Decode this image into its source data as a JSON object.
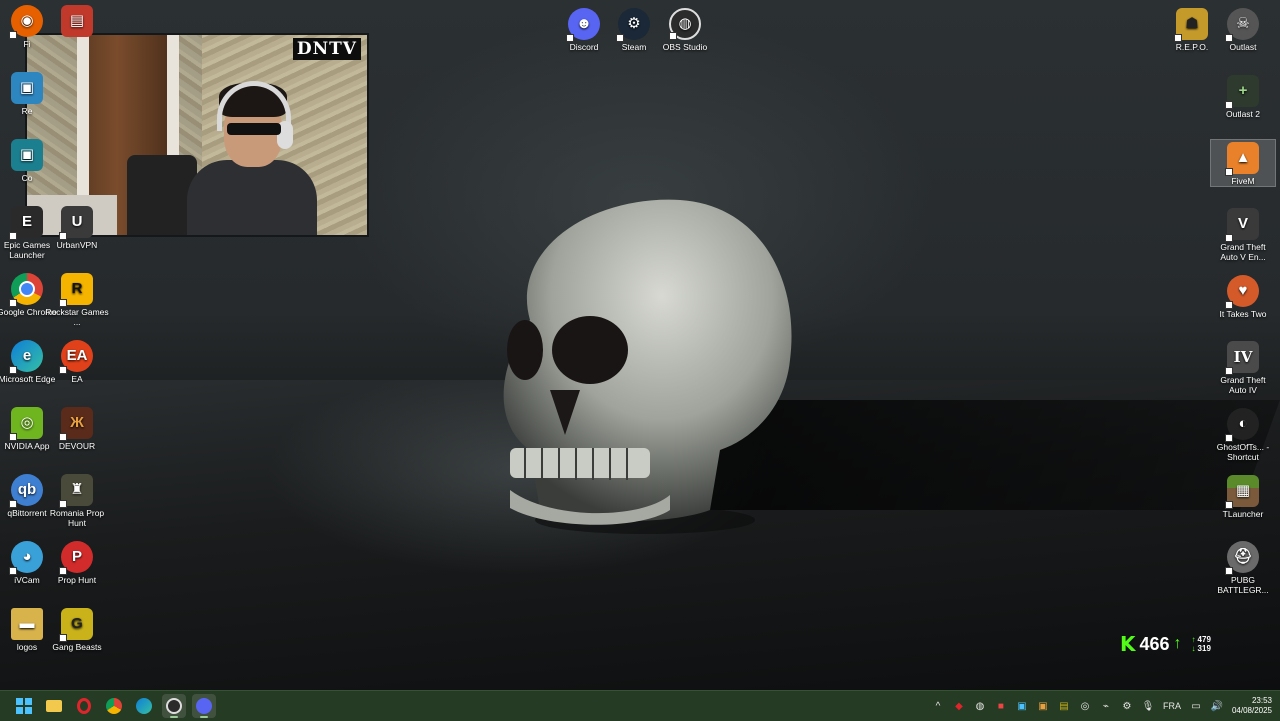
{
  "webcam": {
    "logo_text": "DNTV"
  },
  "desktop_icons": [
    {
      "id": "firefox",
      "label": "Fi",
      "color": "#e66000"
    },
    {
      "id": "recycle",
      "label": "",
      "color": "#c0392b"
    },
    {
      "id": "re",
      "label": "Re",
      "color": "#2e86c1"
    },
    {
      "id": "co",
      "label": "Co",
      "color": "#1b7f8f"
    },
    {
      "id": "epic",
      "label": "Epic Games Launcher",
      "color": "#2a2a2a"
    },
    {
      "id": "urbanvpn",
      "label": "UrbanVPN",
      "color": "#3a3a3a"
    },
    {
      "id": "chrome",
      "label": "Google Chrome",
      "color": "#db4437"
    },
    {
      "id": "rockstar",
      "label": "Rockstar Games ...",
      "color": "#f4b400"
    },
    {
      "id": "edge",
      "label": "Microsoft Edge",
      "color": "#0f7dd8"
    },
    {
      "id": "ea",
      "label": "EA",
      "color": "#e0411a"
    },
    {
      "id": "nvidia",
      "label": "NVIDIA App",
      "color": "#6fb51f"
    },
    {
      "id": "devour",
      "label": "DEVOUR",
      "color": "#5a2a1a"
    },
    {
      "id": "qbittorrent",
      "label": "qBittorrent",
      "color": "#3f7fd1"
    },
    {
      "id": "romania",
      "label": "Romania Prop Hunt",
      "color": "#4a4a3a"
    },
    {
      "id": "ivcam",
      "label": "iVCam",
      "color": "#3aa0d8"
    },
    {
      "id": "prophunt",
      "label": "Prop Hunt",
      "color": "#d22b2b"
    },
    {
      "id": "logos",
      "label": "logos",
      "color": "#d8b24a"
    },
    {
      "id": "gangbeasts",
      "label": "Gang Beasts",
      "color": "#c9b21a"
    },
    {
      "id": "discord",
      "label": "Discord",
      "color": "#5865f2"
    },
    {
      "id": "steam",
      "label": "Steam",
      "color": "#1b2838"
    },
    {
      "id": "obs",
      "label": "OBS Studio",
      "color": "#2b2b2b"
    },
    {
      "id": "repo",
      "label": "R.E.P.O.",
      "color": "#c49a2a"
    },
    {
      "id": "outlast",
      "label": "Outlast",
      "color": "#555"
    },
    {
      "id": "outlast2",
      "label": "Outlast 2",
      "color": "#2e3a2e"
    },
    {
      "id": "fivem",
      "label": "FiveM",
      "color": "#e8812a"
    },
    {
      "id": "gtav",
      "label": "Grand Theft Auto V En...",
      "color": "#3a3a3a"
    },
    {
      "id": "ittakestwo",
      "label": "It Takes Two",
      "color": "#d45a2a"
    },
    {
      "id": "gtaiv",
      "label": "Grand Theft Auto IV",
      "color": "#4a4a4a"
    },
    {
      "id": "ghostofts",
      "label": "GhostOfTs... - Shortcut",
      "color": "#222"
    },
    {
      "id": "tlauncher",
      "label": "TLauncher",
      "color": "#5a8a2a"
    },
    {
      "id": "pubg",
      "label": "PUBG BATTLEGR...",
      "color": "#6a6a6a"
    }
  ],
  "counter": {
    "main": "466",
    "up_value": "479",
    "down_value": "319"
  },
  "tray": {
    "language": "FRA",
    "time": "23:53",
    "date": "04/08/2025"
  },
  "colors": {
    "taskbar": "#263b24",
    "accent": "#53fc18"
  }
}
